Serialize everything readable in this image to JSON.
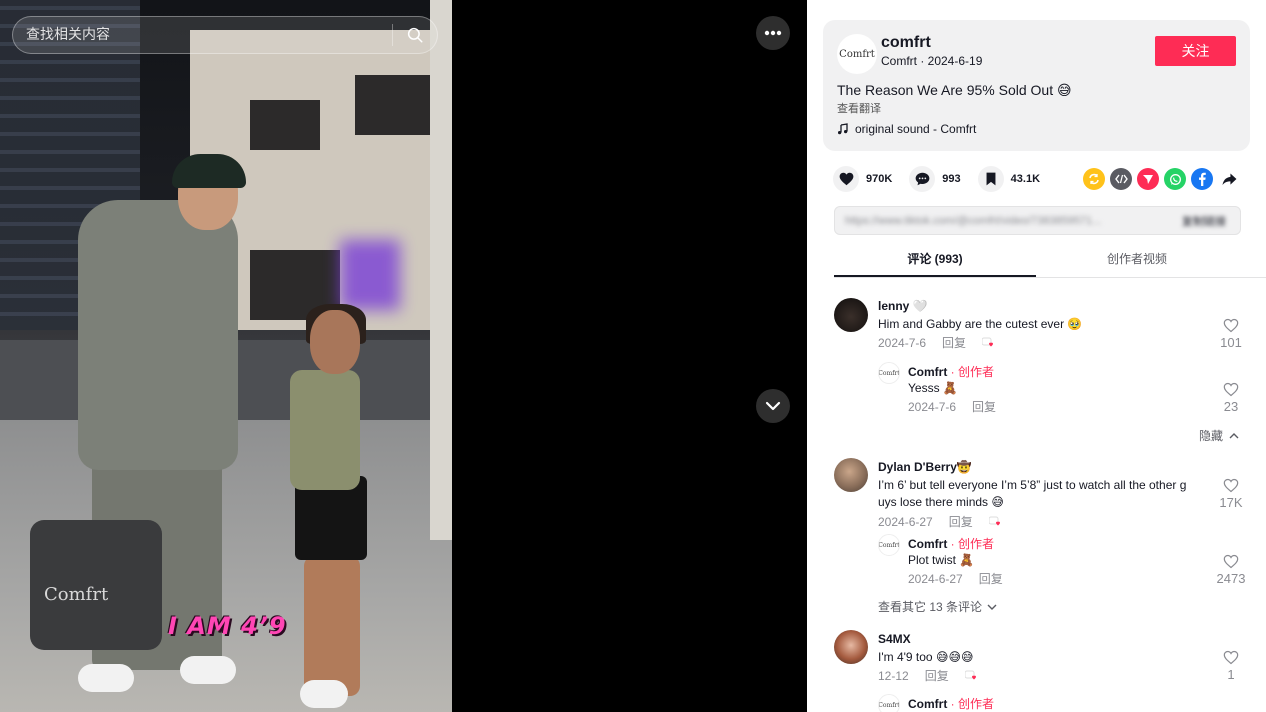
{
  "search": {
    "placeholder": "查找相关内容"
  },
  "video": {
    "overlay_text": "I AM 4’9",
    "bag_text": "Comfrt"
  },
  "post": {
    "creator_logo": "Comfrt",
    "creator_handle": "comfrt",
    "creator_sub": "Comfrt · 2024-6-19",
    "follow_label": "关注",
    "title": "The Reason We Are 95% Sold Out 😅",
    "translate_label": "查看翻译",
    "sound": "original sound - Comfrt"
  },
  "actions": {
    "likes": "970K",
    "comments": "993",
    "saves": "43.1K"
  },
  "share": [
    {
      "icon": "repost-icon",
      "color": "#ffc21a"
    },
    {
      "icon": "embed-icon",
      "color": "#5a5b62"
    },
    {
      "icon": "send-icon",
      "color": "#fe2c55"
    },
    {
      "icon": "whatsapp-icon",
      "color": "#25d366"
    },
    {
      "icon": "facebook-icon",
      "color": "#1877f2"
    },
    {
      "icon": "share-arrow-icon",
      "color": "#161823"
    }
  ],
  "link": {
    "url": "https://www.tiktok.com/@comfrt/video/7383859571...",
    "copy_label": "复制链接"
  },
  "tabs": {
    "comments_label": "评论 (993)",
    "videos_label": "创作者视频"
  },
  "comments": [
    {
      "user": "lenny 🤍",
      "text": "Him and Gabby are the cutest ever 🥹",
      "date": "2024-7-6",
      "reply_label": "回复",
      "likes": "101",
      "reply": {
        "user": "Comfrt",
        "tag": " · 创作者",
        "logo": "Comfrt",
        "text": "Yesss 🧸",
        "date": "2024-7-6",
        "reply_label": "回复",
        "likes": "23"
      },
      "hide_label": "隐藏"
    },
    {
      "user": "Dylan D'Berry🤠",
      "text1": "I’m 6’ but tell everyone I’m 5’8” just to watch all the other g",
      "text2": "uys lose there minds 😅",
      "date": "2024-6-27",
      "reply_label": "回复",
      "likes": "17K",
      "reply": {
        "user": "Comfrt",
        "tag": " · 创作者",
        "logo": "Comfrt",
        "text": "Plot twist 🧸",
        "date": "2024-6-27",
        "reply_label": "回复",
        "likes": "2473"
      },
      "view_more": "查看其它 13 条评论"
    },
    {
      "user": "S4MX",
      "text": "I'm 4'9 too 😅😅😅",
      "date": "12-12",
      "reply_label": "回复",
      "likes": "1",
      "reply": {
        "user": "Comfrt",
        "tag": " · 创作者",
        "logo": "Comfrt"
      }
    }
  ]
}
